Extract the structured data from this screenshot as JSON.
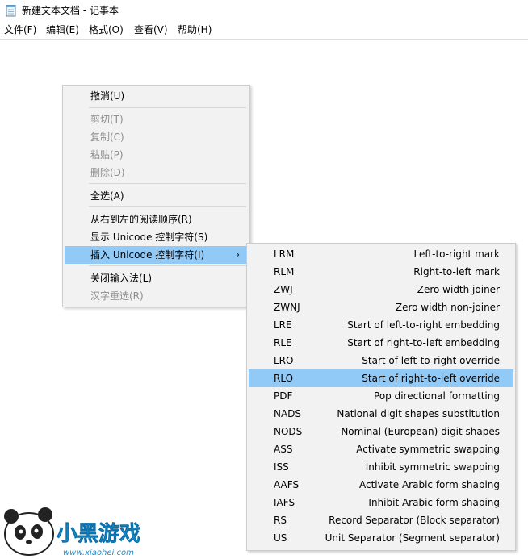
{
  "window": {
    "title": "新建文本文档 - 记事本",
    "icon": "notepad-icon"
  },
  "menubar": [
    "文件(F)",
    "编辑(E)",
    "格式(O)",
    "查看(V)",
    "帮助(H)"
  ],
  "context_menu": {
    "items": [
      {
        "label": "撤消(U)"
      },
      {
        "label": "剪切(T)"
      },
      {
        "label": "复制(C)"
      },
      {
        "label": "粘贴(P)"
      },
      {
        "label": "删除(D)"
      },
      {
        "label": "全选(A)"
      },
      {
        "label": "从右到左的阅读顺序(R)"
      },
      {
        "label": "显示 Unicode 控制字符(S)"
      },
      {
        "label": "插入 Unicode 控制字符(I)",
        "submenu_arrow": "›"
      },
      {
        "label": "关闭输入法(L)"
      },
      {
        "label": "汉字重选(R)"
      }
    ]
  },
  "submenu": {
    "items": [
      {
        "code": "LRM",
        "desc": "Left-to-right mark"
      },
      {
        "code": "RLM",
        "desc": "Right-to-left mark"
      },
      {
        "code": "ZWJ",
        "desc": "Zero width joiner"
      },
      {
        "code": "ZWNJ",
        "desc": "Zero width non-joiner"
      },
      {
        "code": "LRE",
        "desc": "Start of left-to-right embedding"
      },
      {
        "code": "RLE",
        "desc": "Start of right-to-left embedding"
      },
      {
        "code": "LRO",
        "desc": "Start of left-to-right override"
      },
      {
        "code": "RLO",
        "desc": "Start of right-to-left override"
      },
      {
        "code": "PDF",
        "desc": "Pop directional formatting"
      },
      {
        "code": "NADS",
        "desc": "National digit shapes substitution"
      },
      {
        "code": "NODS",
        "desc": "Nominal (European) digit shapes"
      },
      {
        "code": "ASS",
        "desc": "Activate symmetric swapping"
      },
      {
        "code": "ISS",
        "desc": "Inhibit symmetric swapping"
      },
      {
        "code": "AAFS",
        "desc": "Activate Arabic form shaping"
      },
      {
        "code": "IAFS",
        "desc": "Inhibit Arabic form shaping"
      },
      {
        "code": "RS",
        "desc": "Record Separator (Block separator)"
      },
      {
        "code": "US",
        "desc": "Unit Separator (Segment separator)"
      }
    ]
  },
  "watermark": {
    "brand": "小黑游戏",
    "url": "www.xiaohei.com"
  },
  "colors": {
    "highlight": "#91c9f7",
    "menu_bg": "#f2f2f2",
    "disabled_text": "#8d8d8d"
  }
}
